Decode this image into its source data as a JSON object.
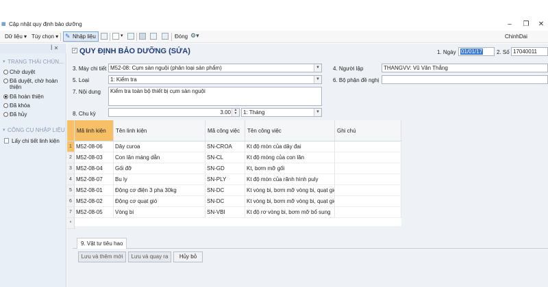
{
  "window": {
    "title": "Cập nhật quy định bảo dưỡng",
    "controls": [
      "–",
      "❐",
      "✕"
    ]
  },
  "toolbar": {
    "du_lieu": "Dữ liệu ▾",
    "tuy_chon": "Tùy chọn ▾",
    "nhap_lieu": "Nhập liệu",
    "dong": "Đóng",
    "user": "ChinhDai"
  },
  "left_panel": {
    "pin_glyphs": "ꟾ ✕",
    "status_section": "TRẠNG THÁI CHÚN...",
    "statuses": [
      {
        "label": "Chờ duyệt",
        "selected": false
      },
      {
        "label": "Đã duyệt, chờ hoàn thiện",
        "selected": false
      },
      {
        "label": "Đã hoàn thiện",
        "selected": true
      },
      {
        "label": "Đã khóa",
        "selected": false
      },
      {
        "label": "Đã hủy",
        "selected": false
      }
    ],
    "tools_section": "CÔNG CỤ NHẬP LIỆU",
    "tool_item": "Lấy chi tiết linh kiện"
  },
  "form": {
    "title": "QUY ĐỊNH BẢO DƯỠNG (SỬA)",
    "ngay_label": "1. Ngày",
    "ngay_value": "01/01/17",
    "so_label": "2. Số",
    "so_value": "17040011",
    "may_label": "3. Máy chi tiết",
    "may_value": "M52-08: Cụm sàn nguội (phân loại sản phẩm)",
    "nguoi_lap_label": "4. Người lập",
    "nguoi_lap_value": "THANGVV: Vũ Văn Thắng",
    "loai_label": "5. Loại",
    "loai_value": "1: Kiểm tra",
    "bo_phan_label": "6. Bộ phận đề nghị",
    "bo_phan_value": "",
    "noi_dung_label": "7. Nội dung",
    "noi_dung_value": "Kiểm tra toàn bộ thiết bị cụm sàn nguội",
    "chu_ky_label": "8. Chu kỳ",
    "chu_ky_value": "3.00",
    "chu_ky_unit": "1: Tháng"
  },
  "grid": {
    "columns": [
      "Mã linh kiện",
      "Tên linh kiện",
      "Mã công việc",
      "Tên công việc",
      "Ghi chú"
    ],
    "rows": [
      [
        "M52-08-06",
        "Dây curoa",
        "SN-CROA",
        "Kt độ mòn của dây đai",
        ""
      ],
      [
        "M52-08-03",
        "Con lăn máng dẫn",
        "SN-CL",
        "Kt độ mòng của con lăn",
        ""
      ],
      [
        "M52-08-04",
        "Gối đỡ",
        "SN-GD",
        "Kt, bơm mỡ gối",
        ""
      ],
      [
        "M52-08-07",
        "Bu ly",
        "SN-PLY",
        "Kt độ mòn của rãnh hình puly",
        ""
      ],
      [
        "M52-08-01",
        "Động cơ điện 3 pha 30kg",
        "SN-DC",
        "Kt vòng bi, bơm mỡ vòng bi, quạt gió",
        ""
      ],
      [
        "M52-08-02",
        "Động cơ quạt gió",
        "SN-DC",
        "Kt vòng bi, bơm mỡ vòng bi, quạt gió",
        ""
      ],
      [
        "M52-08-05",
        "Vòng bi",
        "SN-VBI",
        "Kt độ rơ vòng bi, bơm mỡ bổ sung",
        ""
      ]
    ],
    "new_row_marker": "*"
  },
  "tabs": {
    "vat_tu": "9. Vật tư tiêu hao"
  },
  "buttons": {
    "save_new": "Lưu và thêm mới",
    "save_back": "Lưu và quay ra",
    "cancel": "Hủy bỏ"
  }
}
